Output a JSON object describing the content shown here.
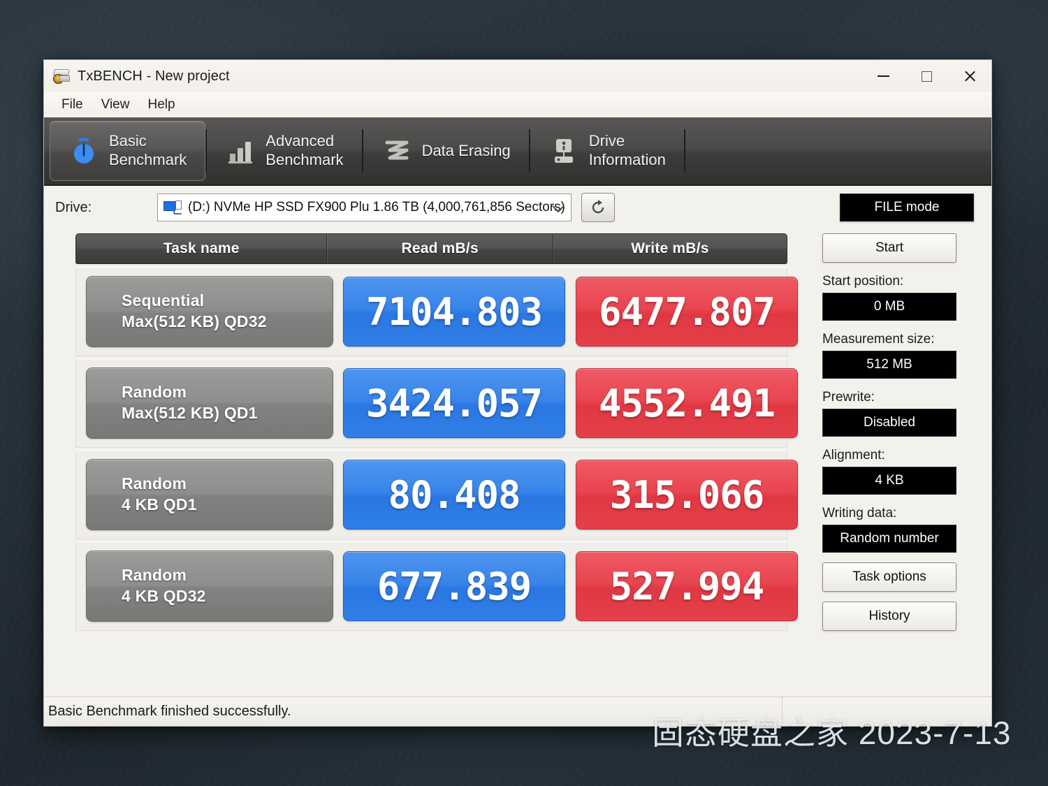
{
  "window": {
    "title": "TxBENCH - New project",
    "app_icon": "txbench-app-icon",
    "controls": {
      "minimize": "minimize-icon",
      "maximize": "maximize-icon",
      "close": "close-icon"
    }
  },
  "menubar": {
    "items": [
      {
        "label": "File"
      },
      {
        "label": "View"
      },
      {
        "label": "Help"
      }
    ]
  },
  "toolbar": {
    "tabs": [
      {
        "label": "Basic\nBenchmark",
        "icon": "stopwatch-icon",
        "active": true
      },
      {
        "label": "Advanced\nBenchmark",
        "icon": "bar-chart-icon",
        "active": false
      },
      {
        "label": "Data Erasing",
        "icon": "eraser-wave-icon",
        "active": false
      },
      {
        "label": "Drive\nInformation",
        "icon": "drive-info-icon",
        "active": false
      }
    ]
  },
  "drive": {
    "label": "Drive:",
    "icon": "drive-monitor-icon",
    "value": "(D:) NVMe HP SSD FX900 Plu  1.86 TB (4,000,761,856 Sectors)",
    "dropdown_icon": "chevron-down-icon",
    "refresh_icon": "refresh-icon"
  },
  "results": {
    "columns": [
      "Task name",
      "Read mB/s",
      "Write mB/s"
    ],
    "rows": [
      {
        "task_line1": "Sequential",
        "task_line2": "Max(512 KB) QD32",
        "read": "7104.803",
        "write": "6477.807"
      },
      {
        "task_line1": "Random",
        "task_line2": "Max(512 KB) QD1",
        "read": "3424.057",
        "write": "4552.491"
      },
      {
        "task_line1": "Random",
        "task_line2": "4 KB QD1",
        "read": "80.408",
        "write": "315.066"
      },
      {
        "task_line1": "Random",
        "task_line2": "4 KB QD32",
        "read": "677.839",
        "write": "527.994"
      }
    ]
  },
  "side_panel": {
    "mode_button": "FILE mode",
    "start_button": "Start",
    "start_position_label": "Start position:",
    "start_position_value": "0 MB",
    "measurement_size_label": "Measurement size:",
    "measurement_size_value": "512 MB",
    "prewrite_label": "Prewrite:",
    "prewrite_value": "Disabled",
    "alignment_label": "Alignment:",
    "alignment_value": "4 KB",
    "writing_data_label": "Writing data:",
    "writing_data_value": "Random number",
    "task_options_button": "Task options",
    "history_button": "History"
  },
  "statusbar": {
    "message": "Basic Benchmark finished successfully."
  },
  "watermark": {
    "text": "固态硬盘之家 2023-7-13"
  },
  "colors": {
    "read_blue": "#3884ea",
    "write_red": "#e8454f",
    "task_grey": "#8e8e8c",
    "value_field_black": "#000000",
    "toolbar_dark": "#4b4a48",
    "window_chrome": "#f3f1ec"
  },
  "chart_data": {
    "type": "table",
    "title": "TxBENCH Basic Benchmark results",
    "columns": [
      "Task name",
      "Read mB/s",
      "Write mB/s"
    ],
    "categories": [
      "Sequential Max(512 KB) QD32",
      "Random Max(512 KB) QD1",
      "Random 4 KB QD1",
      "Random 4 KB QD32"
    ],
    "series": [
      {
        "name": "Read mB/s",
        "values": [
          7104.803,
          3424.057,
          80.408,
          677.839
        ]
      },
      {
        "name": "Write mB/s",
        "values": [
          6477.807,
          4552.491,
          315.066,
          527.994
        ]
      }
    ],
    "ylabel": "mB/s"
  }
}
